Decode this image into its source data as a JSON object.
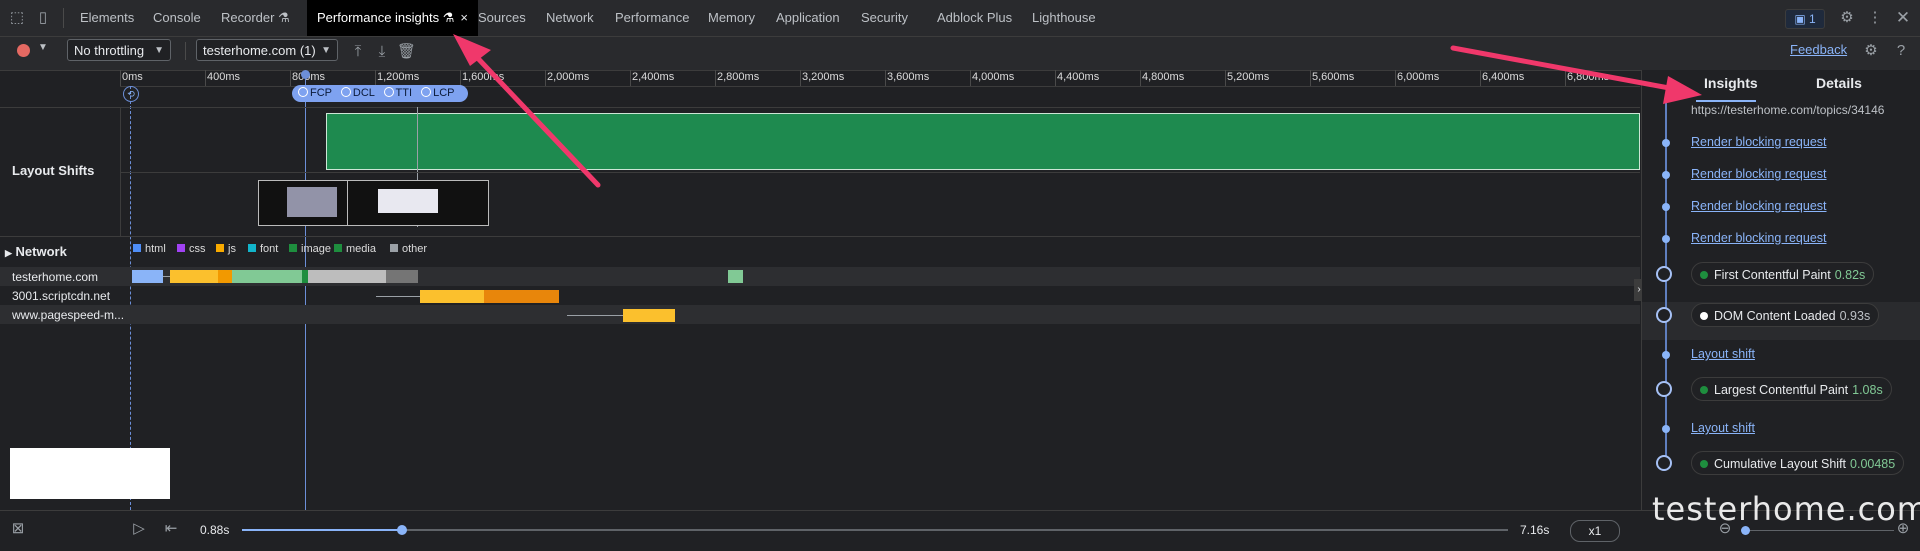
{
  "tabs": [
    {
      "label": "Elements"
    },
    {
      "label": "Console"
    },
    {
      "label": "Recorder"
    },
    {
      "label": "Performance insights",
      "close": "×"
    },
    {
      "label": "Sources"
    },
    {
      "label": "Network"
    },
    {
      "label": "Performance"
    },
    {
      "label": "Memory"
    },
    {
      "label": "Application"
    },
    {
      "label": "Security"
    },
    {
      "label": "Adblock Plus"
    },
    {
      "label": "Lighthouse"
    }
  ],
  "issues_count": "1",
  "toolbar": {
    "throttling": "No throttling",
    "recording": "testerhome.com (1)",
    "feedback": "Feedback"
  },
  "ruler_ticks": [
    "0ms",
    "400ms",
    "800ms",
    "1,200ms",
    "1,600ms",
    "2,000ms",
    "2,400ms",
    "2,800ms",
    "3,200ms",
    "3,600ms",
    "4,000ms",
    "4,400ms",
    "4,800ms",
    "5,200ms",
    "5,600ms",
    "6,000ms",
    "6,400ms",
    "6,800ms"
  ],
  "markers": [
    "FCP",
    "DCL",
    "TTI",
    "LCP"
  ],
  "layout_shifts_label": "Layout Shifts",
  "network": {
    "label": "Network",
    "legend": [
      {
        "label": "html",
        "color": "#4f8ef7"
      },
      {
        "label": "css",
        "color": "#a142f4"
      },
      {
        "label": "js",
        "color": "#f9ab00"
      },
      {
        "label": "font",
        "color": "#12b5cb"
      },
      {
        "label": "image",
        "color": "#1e8e3e"
      },
      {
        "label": "media",
        "color": "#1e8e3e"
      },
      {
        "label": "other",
        "color": "#9aa0a6"
      }
    ],
    "rows": [
      {
        "name": "testerhome.com"
      },
      {
        "name": "3001.scriptcdn.net"
      },
      {
        "name": "www.pagespeed-m..."
      }
    ]
  },
  "right_panel": {
    "tabs": [
      "Insights",
      "Details"
    ],
    "url": "https://testerhome.com/topics/34146",
    "links": [
      "Render blocking request",
      "Render blocking request",
      "Render blocking request",
      "Render blocking request",
      "Layout shift",
      "Layout shift"
    ],
    "metrics": [
      {
        "label": "First Contentful Paint",
        "value": "0.82s",
        "color": "#1e8e3e"
      },
      {
        "label": "DOM Content Loaded",
        "value": "0.93s",
        "color": "#ffffff"
      },
      {
        "label": "Largest Contentful Paint",
        "value": "1.08s",
        "color": "#1e8e3e"
      },
      {
        "label": "Cumulative Layout Shift",
        "value": "0.00485",
        "color": "#1e8e3e"
      }
    ]
  },
  "playback": {
    "current": "0.88s",
    "total": "7.16s",
    "speed": "x1"
  },
  "watermark": "testerhome.com",
  "colors": {
    "accent": "#8ab4f8",
    "arrow": "#f0386b"
  }
}
